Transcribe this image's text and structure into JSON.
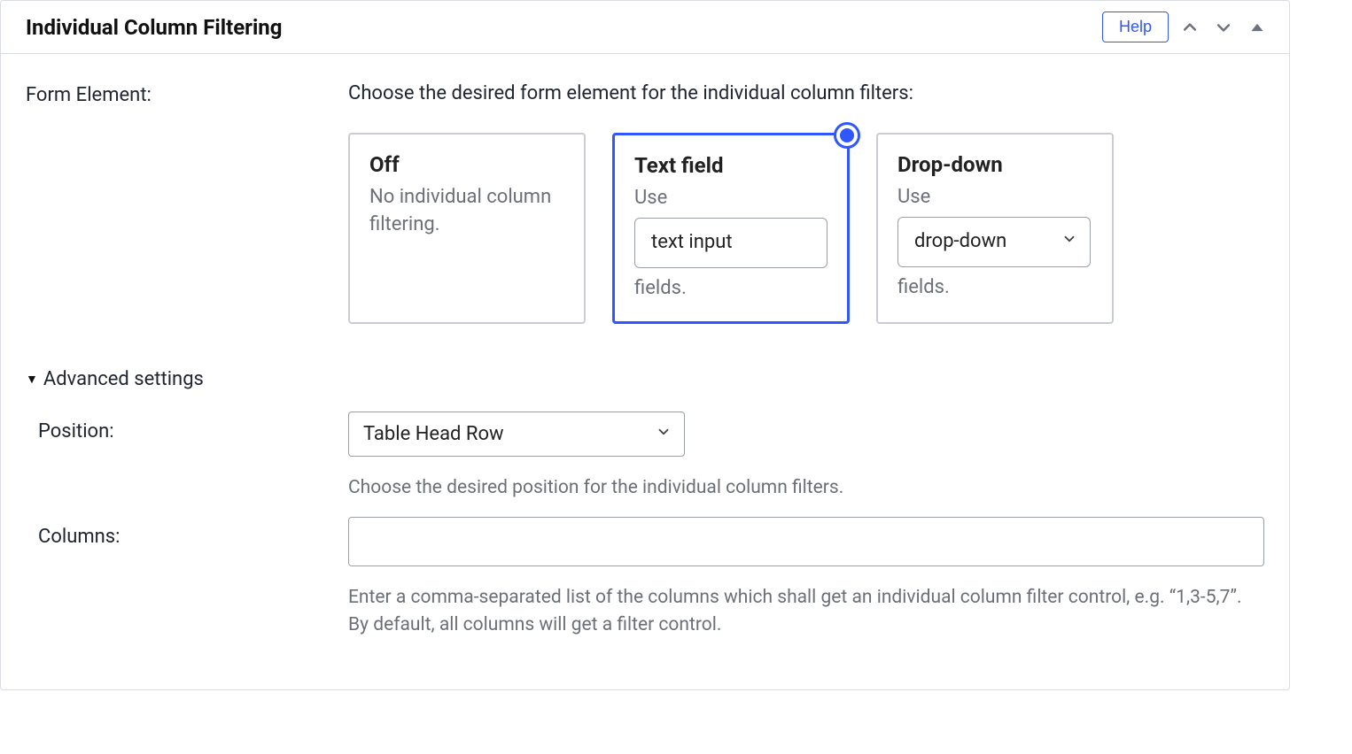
{
  "panel": {
    "title": "Individual Column Filtering",
    "help_label": "Help"
  },
  "form_element": {
    "label": "Form Element:",
    "intro": "Choose the desired form element for the individual column filters:",
    "cards": {
      "off": {
        "title": "Off",
        "sub": "No individual column filtering."
      },
      "text": {
        "title": "Text field",
        "pre": "Use",
        "input_value": "text input",
        "post": "fields."
      },
      "dropdown": {
        "title": "Drop-down",
        "pre": "Use",
        "select_value": "drop-down",
        "post": "fields."
      }
    }
  },
  "advanced": {
    "toggle_label": "Advanced settings",
    "position": {
      "label": "Position:",
      "value": "Table Head Row",
      "helper": "Choose the desired position for the individual column filters."
    },
    "columns": {
      "label": "Columns:",
      "value": "",
      "helper": "Enter a comma-separated list of the columns which shall get an individual column filter control, e.g. “1,3-5,7”. By default, all columns will get a filter control."
    }
  }
}
